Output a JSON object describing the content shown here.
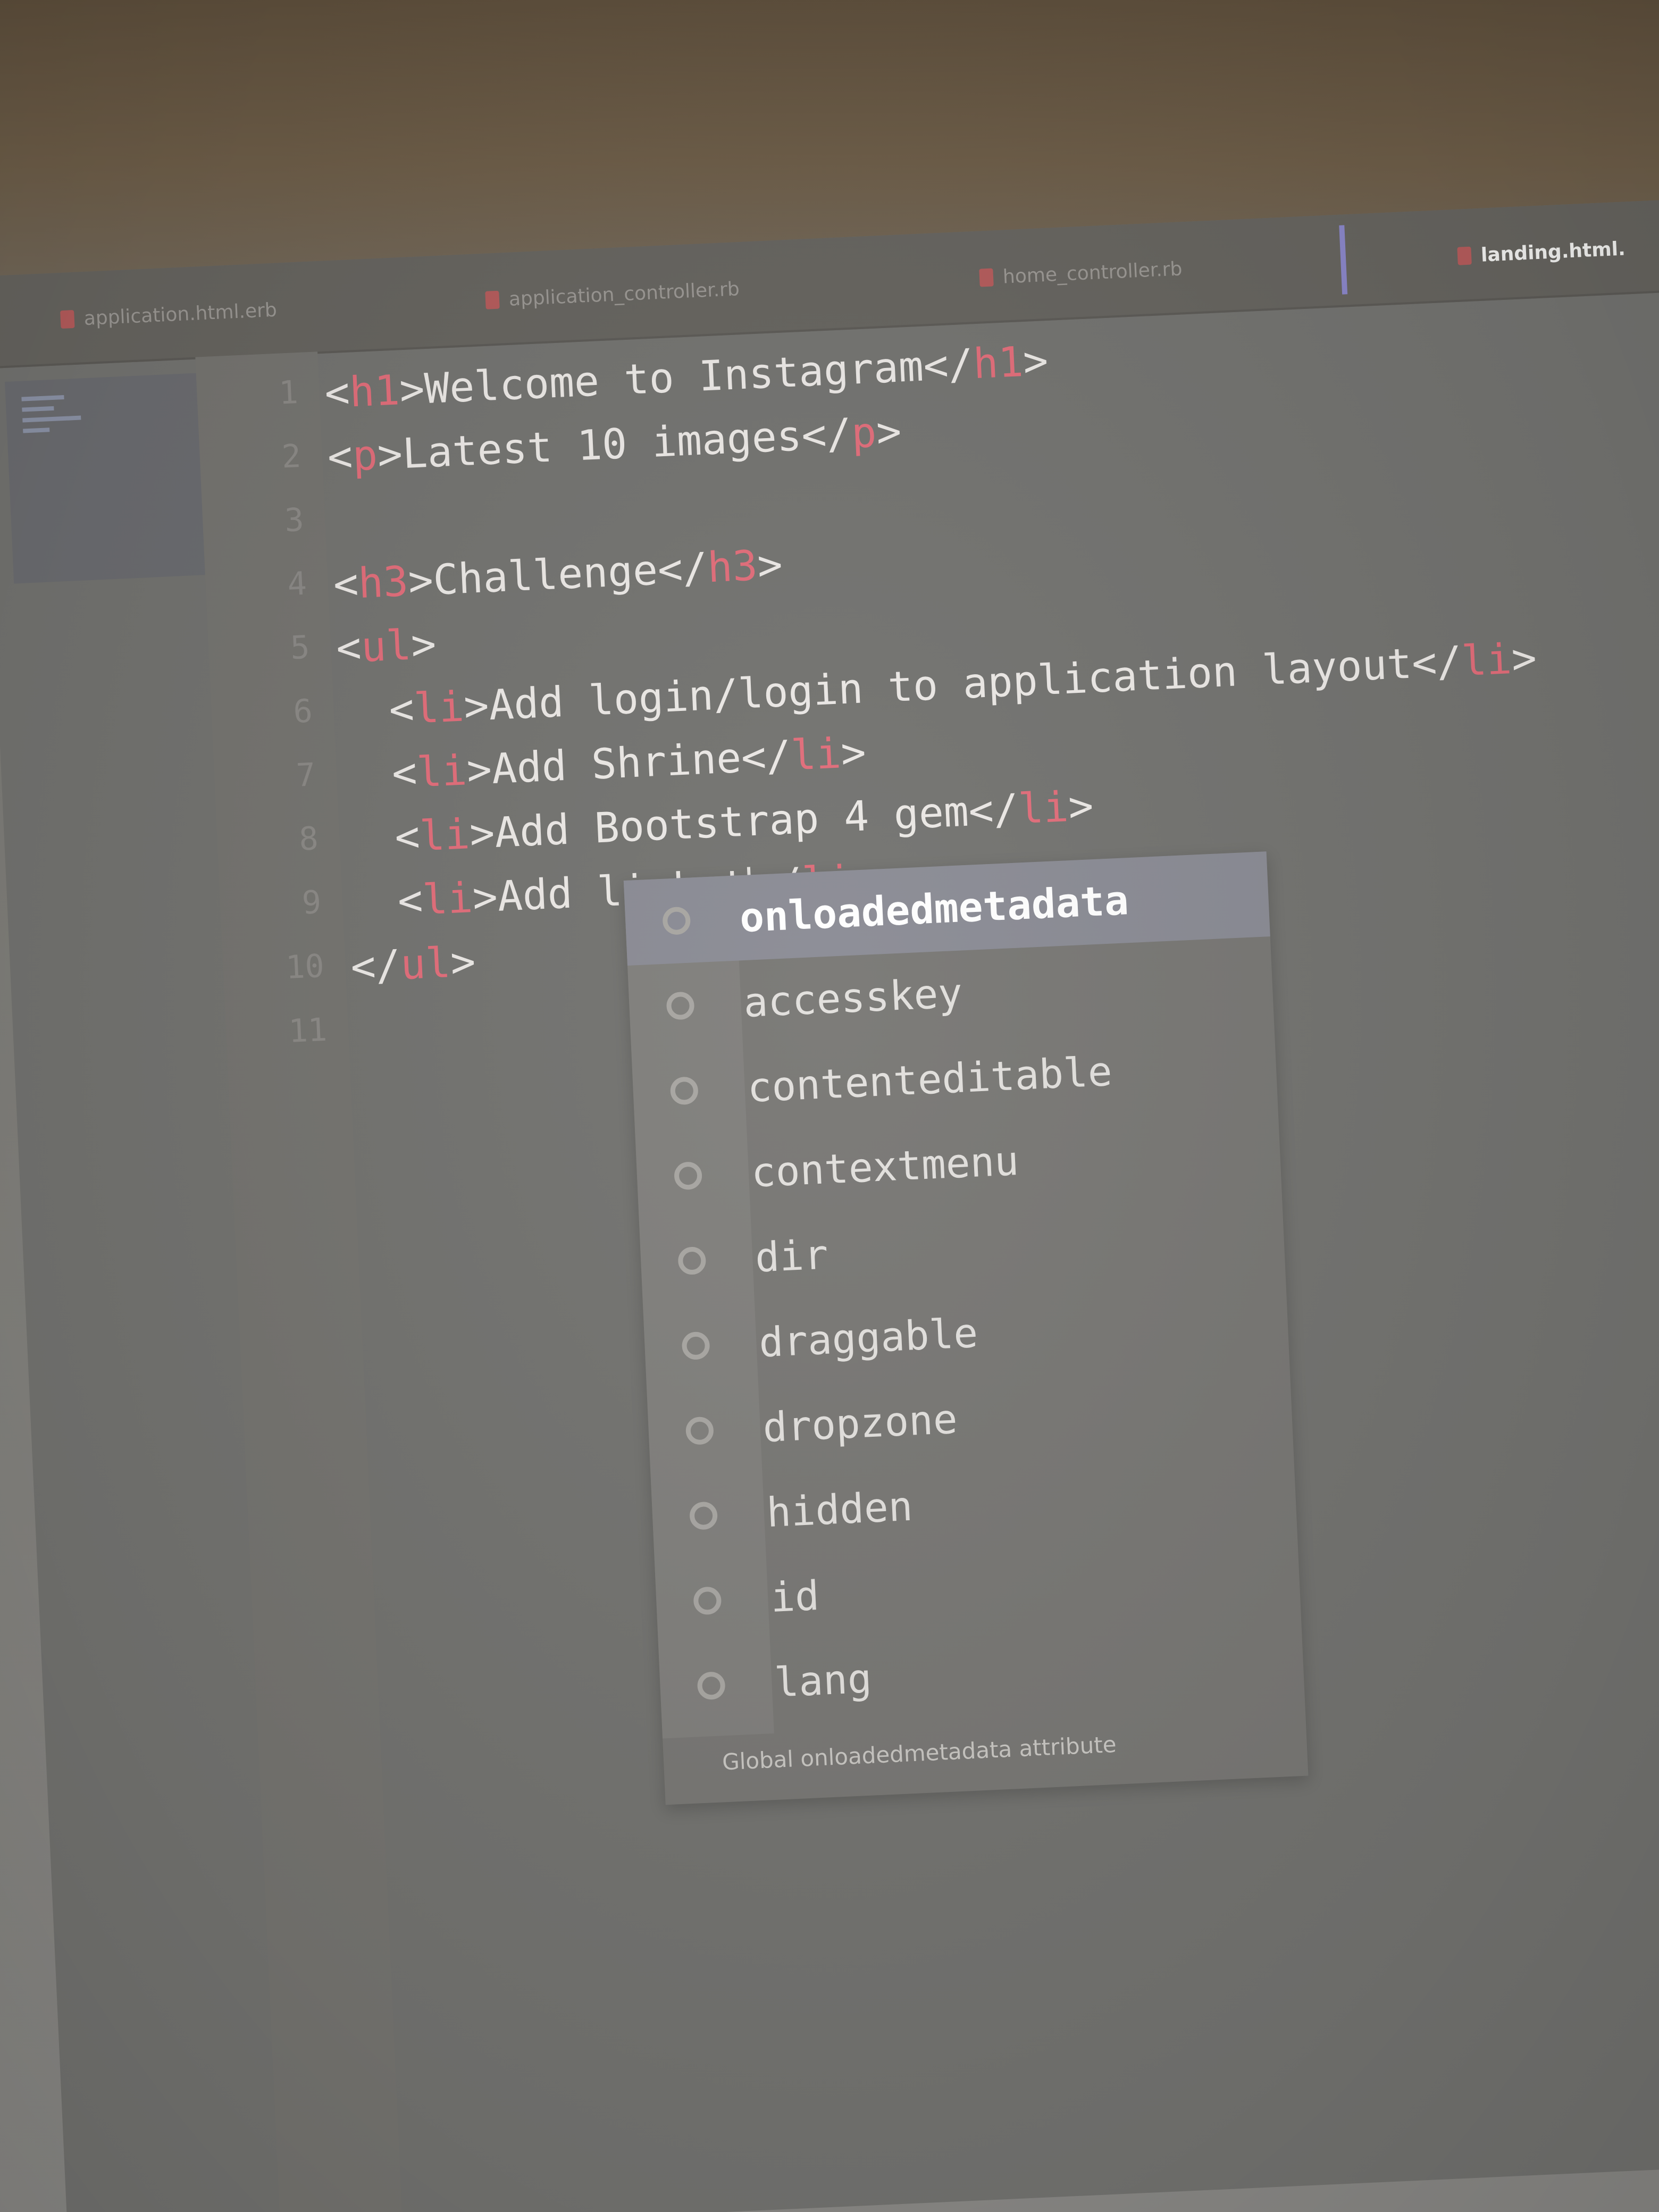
{
  "tabs": [
    {
      "label": "application.html.erb",
      "icon": "ruby-file-icon",
      "active": false
    },
    {
      "label": "application_controller.rb",
      "icon": "ruby-file-icon",
      "active": false
    },
    {
      "label": "home_controller.rb",
      "icon": "ruby-file-icon",
      "active": false
    },
    {
      "label": "landing.html.",
      "icon": "ruby-file-icon",
      "active": true
    }
  ],
  "gutter": {
    "line_numbers": [
      "1",
      "2",
      "3",
      "4",
      "5",
      "6",
      "7",
      "8",
      "9",
      "10",
      "11"
    ]
  },
  "code": {
    "lines": [
      {
        "open": "<",
        "tag": "h1",
        "close": ">",
        "text": "Welcome to Instagram",
        "end_open": "</",
        "end_tag": "h1",
        "end_close": ">"
      },
      {
        "open": "<",
        "tag": "p",
        "close": ">",
        "text": "Latest 10 images",
        "end_open": "</",
        "end_tag": "p",
        "end_close": ">"
      },
      {
        "empty": true
      },
      {
        "open": "<",
        "tag": "h3",
        "close": ">",
        "text": "Challenge",
        "end_open": "</",
        "end_tag": "h3",
        "end_close": ">"
      },
      {
        "open": "<",
        "tag": "ul",
        "close": ">"
      },
      {
        "indent": "  ",
        "open": "<",
        "tag": "li",
        "close": ">",
        "text": "Add login/login to application layout",
        "end_open": "</",
        "end_tag": "li",
        "end_close": ">"
      },
      {
        "indent": "  ",
        "open": "<",
        "tag": "li",
        "close": ">",
        "text": "Add Shrine",
        "end_open": "</",
        "end_tag": "li",
        "end_close": ">"
      },
      {
        "indent": "  ",
        "open": "<",
        "tag": "li",
        "close": ">",
        "text": "Add Bootstrap 4 gem",
        "end_open": "</",
        "end_tag": "li",
        "end_close": ">"
      },
      {
        "indent": "  ",
        "open": "<",
        "tag": "li",
        "close": ">",
        "text": "Add link t",
        "caret": true,
        "end_open": "</",
        "end_tag": "li",
        "end_close": ">"
      },
      {
        "open": "</",
        "tag": "ul",
        "close": ">"
      }
    ]
  },
  "autocomplete": {
    "items": [
      {
        "label": "onloadedmetadata",
        "selected": true
      },
      {
        "label": "accesskey"
      },
      {
        "label": "contenteditable"
      },
      {
        "label": "contextmenu"
      },
      {
        "label": "dir"
      },
      {
        "label": "draggable"
      },
      {
        "label": "dropzone"
      },
      {
        "label": "hidden"
      },
      {
        "label": "id"
      },
      {
        "label": "lang"
      }
    ],
    "item_icon": "attribute-icon",
    "description": "Global onloadedmetadata attribute"
  },
  "colors": {
    "tag": "#e26d7a",
    "text": "#ece9e6",
    "active_tab_marker": "#8a86c9",
    "selected_item_bg": "#8a8b94"
  }
}
